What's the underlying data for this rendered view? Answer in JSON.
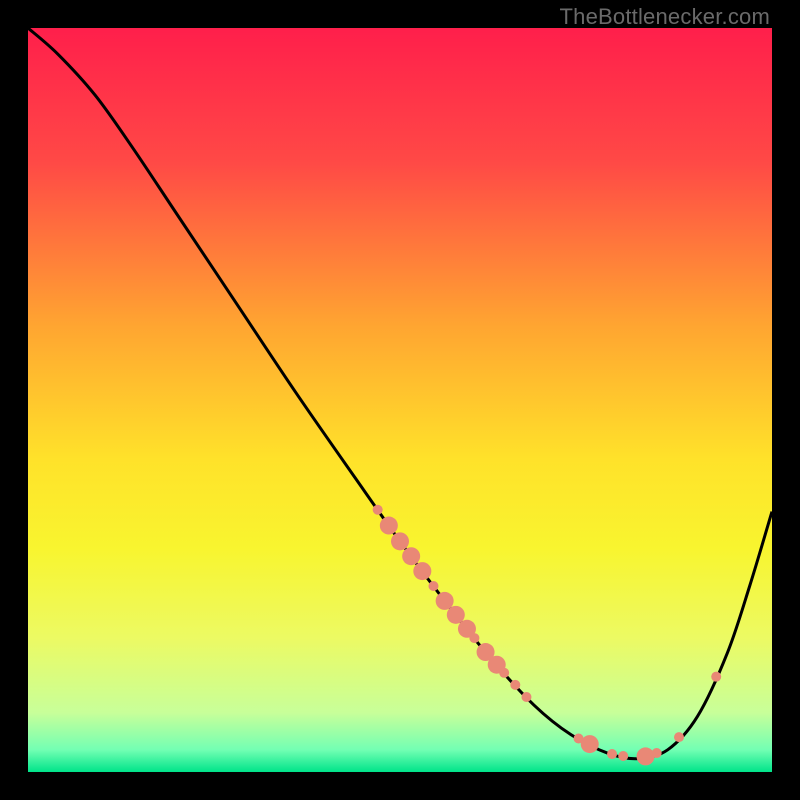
{
  "watermark": "TheBottlenecker.com",
  "chart_data": {
    "type": "line",
    "title": "",
    "xlabel": "",
    "ylabel": "",
    "xlim": [
      0,
      100
    ],
    "ylim": [
      0,
      100
    ],
    "background_gradient": {
      "stops": [
        {
          "y": 0,
          "color": "#ff1f4b"
        },
        {
          "y": 18,
          "color": "#ff4946"
        },
        {
          "y": 40,
          "color": "#ffa531"
        },
        {
          "y": 58,
          "color": "#ffe22a"
        },
        {
          "y": 70,
          "color": "#f8f52f"
        },
        {
          "y": 82,
          "color": "#ecfa63"
        },
        {
          "y": 92,
          "color": "#c8ff99"
        },
        {
          "y": 97,
          "color": "#73ffb3"
        },
        {
          "y": 100,
          "color": "#00e48a"
        }
      ]
    },
    "series": [
      {
        "name": "bottleneck-curve",
        "comment": "Black curve. y=0 corresponds to top (worst), y=100 bottom (best).",
        "points": [
          {
            "x": 0.0,
            "y": 0.0
          },
          {
            "x": 4.0,
            "y": 3.5
          },
          {
            "x": 9.0,
            "y": 9.0
          },
          {
            "x": 14.0,
            "y": 16.0
          },
          {
            "x": 20.0,
            "y": 25.0
          },
          {
            "x": 28.0,
            "y": 37.0
          },
          {
            "x": 36.0,
            "y": 49.0
          },
          {
            "x": 44.0,
            "y": 60.5
          },
          {
            "x": 50.0,
            "y": 69.0
          },
          {
            "x": 56.0,
            "y": 77.0
          },
          {
            "x": 62.0,
            "y": 84.5
          },
          {
            "x": 68.0,
            "y": 91.0
          },
          {
            "x": 73.0,
            "y": 95.0
          },
          {
            "x": 78.0,
            "y": 97.5
          },
          {
            "x": 82.0,
            "y": 98.2
          },
          {
            "x": 86.0,
            "y": 97.0
          },
          {
            "x": 90.0,
            "y": 92.5
          },
          {
            "x": 94.0,
            "y": 84.0
          },
          {
            "x": 97.0,
            "y": 75.0
          },
          {
            "x": 100.0,
            "y": 65.0
          }
        ]
      }
    ],
    "markers": {
      "comment": "Salmon dots along the curve, interpreted as sample points.",
      "color": "#e98876",
      "radius_small": 5,
      "radius_large": 9,
      "points": [
        {
          "x": 47.0,
          "size": "small"
        },
        {
          "x": 48.5,
          "size": "large"
        },
        {
          "x": 50.0,
          "size": "large"
        },
        {
          "x": 51.5,
          "size": "large"
        },
        {
          "x": 53.0,
          "size": "large"
        },
        {
          "x": 54.5,
          "size": "small"
        },
        {
          "x": 56.0,
          "size": "large"
        },
        {
          "x": 57.5,
          "size": "large"
        },
        {
          "x": 59.0,
          "size": "large"
        },
        {
          "x": 60.0,
          "size": "small"
        },
        {
          "x": 61.5,
          "size": "large"
        },
        {
          "x": 63.0,
          "size": "large"
        },
        {
          "x": 64.0,
          "size": "small"
        },
        {
          "x": 65.5,
          "size": "small"
        },
        {
          "x": 67.0,
          "size": "small"
        },
        {
          "x": 74.0,
          "size": "small"
        },
        {
          "x": 75.5,
          "size": "large"
        },
        {
          "x": 78.5,
          "size": "small"
        },
        {
          "x": 80.0,
          "size": "small"
        },
        {
          "x": 83.0,
          "size": "large"
        },
        {
          "x": 84.5,
          "size": "small"
        },
        {
          "x": 87.5,
          "size": "small"
        },
        {
          "x": 92.5,
          "size": "small"
        }
      ]
    }
  }
}
